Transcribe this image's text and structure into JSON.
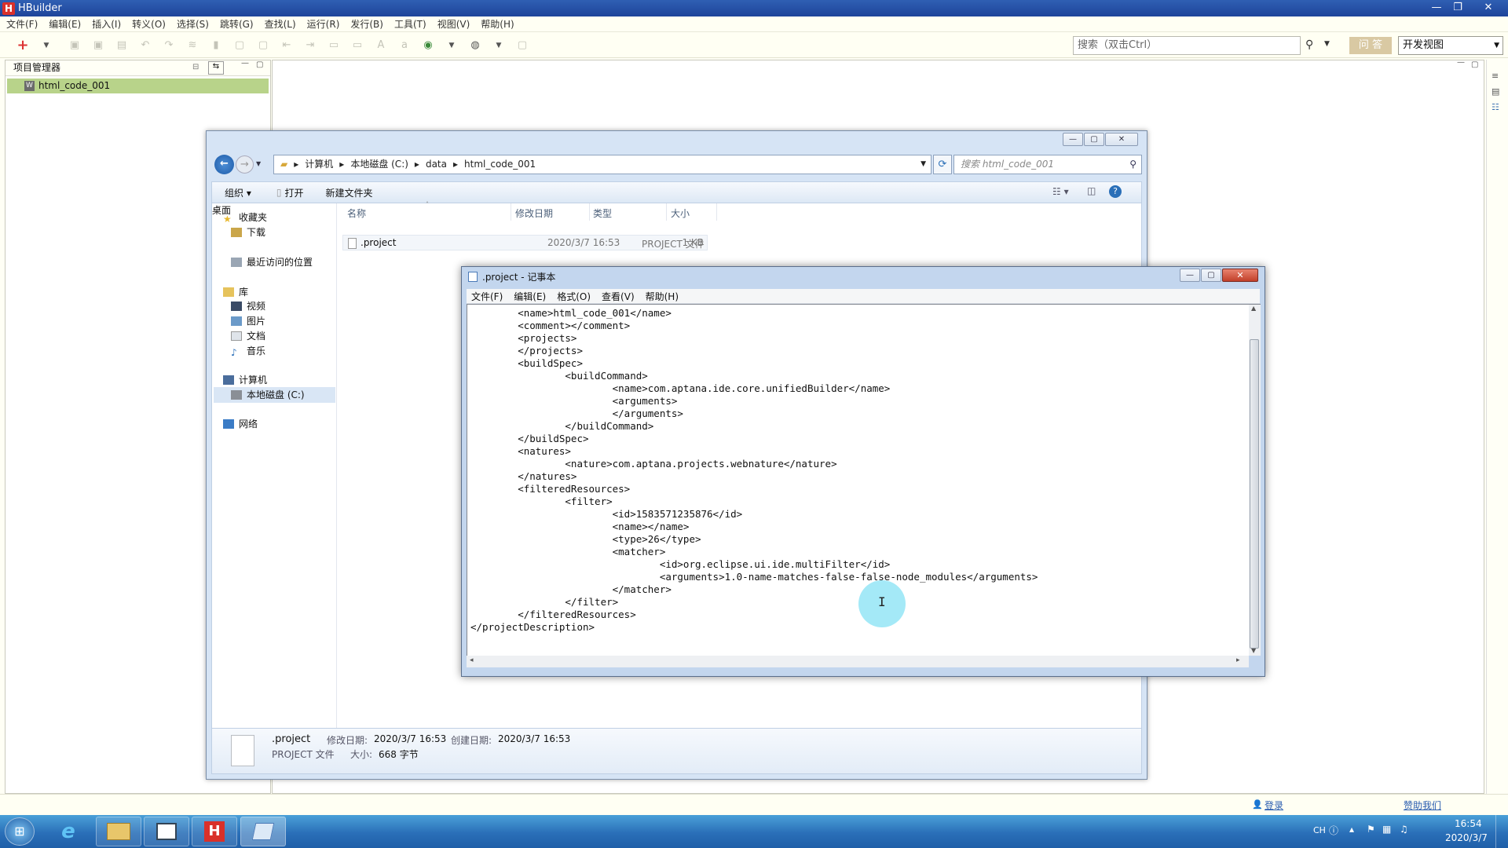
{
  "app": {
    "title": "HBuilder"
  },
  "menu": [
    "文件(F)",
    "编辑(E)",
    "插入(I)",
    "转义(O)",
    "选择(S)",
    "跳转(G)",
    "查找(L)",
    "运行(R)",
    "发行(B)",
    "工具(T)",
    "视图(V)",
    "帮助(H)"
  ],
  "toolbar": {
    "search_placeholder": "搜索（双击Ctrl）",
    "ask_label": "问 答",
    "view_select": "开发视图"
  },
  "project_manager": {
    "title": "项目管理器",
    "project": "html_code_001"
  },
  "statusbar": {
    "login": "登录",
    "help_us": "赞助我们"
  },
  "explorer": {
    "breadcrumb": [
      "计算机",
      "本地磁盘 (C:)",
      "data",
      "html_code_001"
    ],
    "search_placeholder": "搜索 html_code_001",
    "commands": {
      "organize": "组织 ▾",
      "open": "打开",
      "new_folder": "新建文件夹"
    },
    "nav": {
      "favorites": "收藏夹",
      "downloads": "下载",
      "desktop": "桌面",
      "recent": "最近访问的位置",
      "libraries": "库",
      "videos": "视频",
      "pictures": "图片",
      "documents": "文档",
      "music": "音乐",
      "computer": "计算机",
      "local_disk": "本地磁盘 (C:)",
      "network": "网络"
    },
    "columns": {
      "name": "名称",
      "modified": "修改日期",
      "type": "类型",
      "size": "大小"
    },
    "file": {
      "name": ".project",
      "modified": "2020/3/7 16:53",
      "type": "PROJECT 文件",
      "size": "1 KB"
    },
    "details": {
      "name": ".project",
      "type": "PROJECT 文件",
      "modified_label": "修改日期:",
      "modified": "2020/3/7 16:53",
      "created_label": "创建日期:",
      "created": "2020/3/7 16:53",
      "size_label": "大小:",
      "size": "668 字节"
    }
  },
  "notepad": {
    "title": ".project - 记事本",
    "menu": [
      "文件(F)",
      "编辑(E)",
      "格式(O)",
      "查看(V)",
      "帮助(H)"
    ],
    "content": "        <name>html_code_001</name>\n        <comment></comment>\n        <projects>\n        </projects>\n        <buildSpec>\n                <buildCommand>\n                        <name>com.aptana.ide.core.unifiedBuilder</name>\n                        <arguments>\n                        </arguments>\n                </buildCommand>\n        </buildSpec>\n        <natures>\n                <nature>com.aptana.projects.webnature</nature>\n        </natures>\n        <filteredResources>\n                <filter>\n                        <id>1583571235876</id>\n                        <name></name>\n                        <type>26</type>\n                        <matcher>\n                                <id>org.eclipse.ui.ide.multiFilter</id>\n                                <arguments>1.0-name-matches-false-false-node_modules</arguments>\n                        </matcher>\n                </filter>\n        </filteredResources>\n</projectDescription>"
  },
  "taskbar": {
    "lang": "CH",
    "time": "16:54",
    "date": "2020/3/7"
  },
  "colors": {
    "accent_green": "#b8d38a",
    "taskbar_blue": "#2a6fb8",
    "title_blue": "#1e449a"
  }
}
